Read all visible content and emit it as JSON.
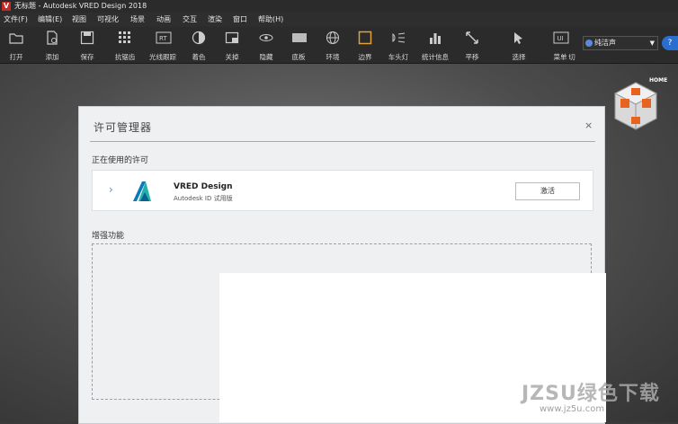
{
  "window": {
    "app_logo": "V",
    "title": "无标题 - Autodesk VRED Design 2018"
  },
  "menu": [
    "文件(F)",
    "编辑(E)",
    "视图",
    "可视化",
    "场景",
    "动画",
    "交互",
    "渲染",
    "窗口",
    "帮助(H)"
  ],
  "toolbar": [
    {
      "label": "打开",
      "icon": "open-folder-icon"
    },
    {
      "label": "添加",
      "icon": "add-file-icon"
    },
    {
      "label": "保存",
      "icon": "save-icon"
    },
    {
      "label": "抗锯齿",
      "icon": "antialiasing-icon"
    },
    {
      "label": "光线跟踪",
      "icon": "raytracing-icon"
    },
    {
      "label": "着色",
      "icon": "shading-icon"
    },
    {
      "label": "关掉",
      "icon": "window-icon"
    },
    {
      "label": "隐藏",
      "icon": "eye-icon"
    },
    {
      "label": "底板",
      "icon": "ground-icon"
    },
    {
      "label": "环境",
      "icon": "environment-icon"
    },
    {
      "label": "边界",
      "icon": "bounds-icon"
    },
    {
      "label": "车头灯",
      "icon": "headlight-icon"
    },
    {
      "label": "统计信息",
      "icon": "statistics-icon"
    },
    {
      "label": "平移",
      "icon": "pan-icon"
    },
    {
      "label": "选择",
      "icon": "select-icon"
    },
    {
      "label": "菜单",
      "icon": "ui-menu-icon"
    },
    {
      "label": "切",
      "icon": ""
    }
  ],
  "user": {
    "name": "纯洁声"
  },
  "navcube": {
    "home_label": "HOME"
  },
  "dialog": {
    "title": "许可管理器",
    "close": "×",
    "section_in_use": "正在使用的许可",
    "license": {
      "product": "VRED Design",
      "detail": "Autodesk ID  试用版",
      "action": "激活"
    },
    "section_more": "增强功能"
  },
  "watermark": {
    "brand": "JZSU绿色下载",
    "url": "www.jz5u.com"
  }
}
